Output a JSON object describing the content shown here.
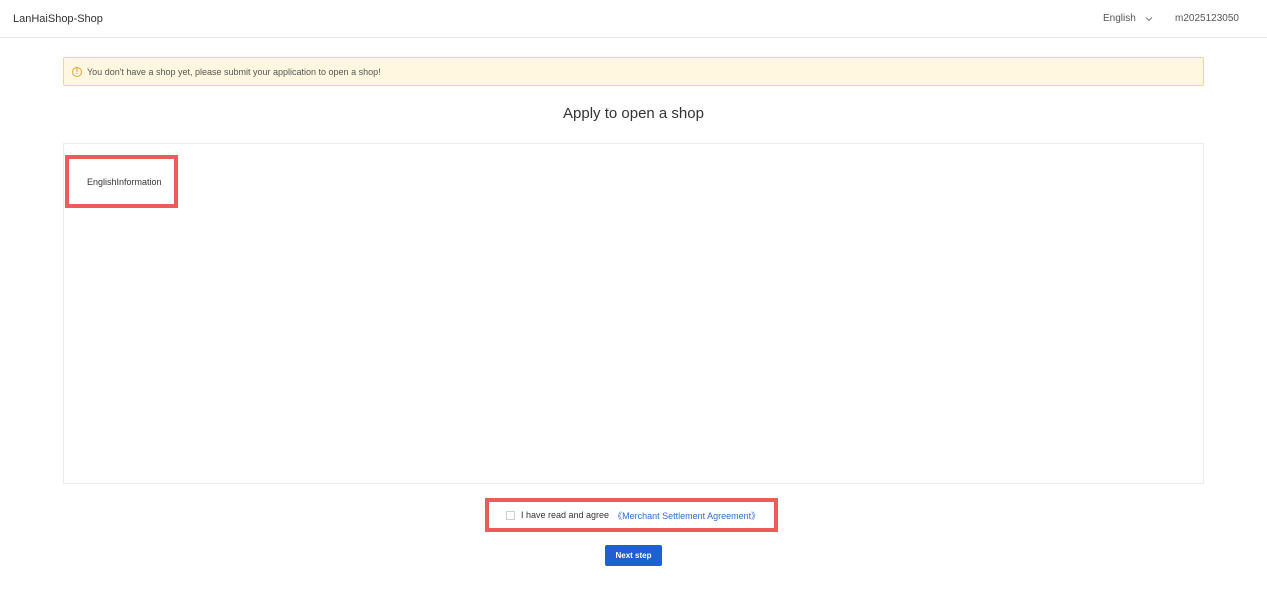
{
  "header": {
    "brand": "LanHaiShop-Shop",
    "language": "English",
    "language_icon": "chevron-down-icon",
    "username": "m2025123050"
  },
  "notice": {
    "icon": "warning-icon",
    "text": "You don't have a shop yet, please submit your application to open a shop!"
  },
  "page": {
    "title": "Apply to open a shop"
  },
  "panel": {
    "tab_label": "EnglishInformation"
  },
  "agreement": {
    "text": "I have read and agree",
    "link": "《Merchant Settlement Agreement》",
    "checked": false
  },
  "actions": {
    "next_label": "Next step"
  },
  "colors": {
    "accent": "#1f5fd1",
    "link": "#2d6bd1",
    "highlight": "#ef5a5a",
    "notice_bg": "#fff7e0",
    "warning": "#e6a23c"
  }
}
